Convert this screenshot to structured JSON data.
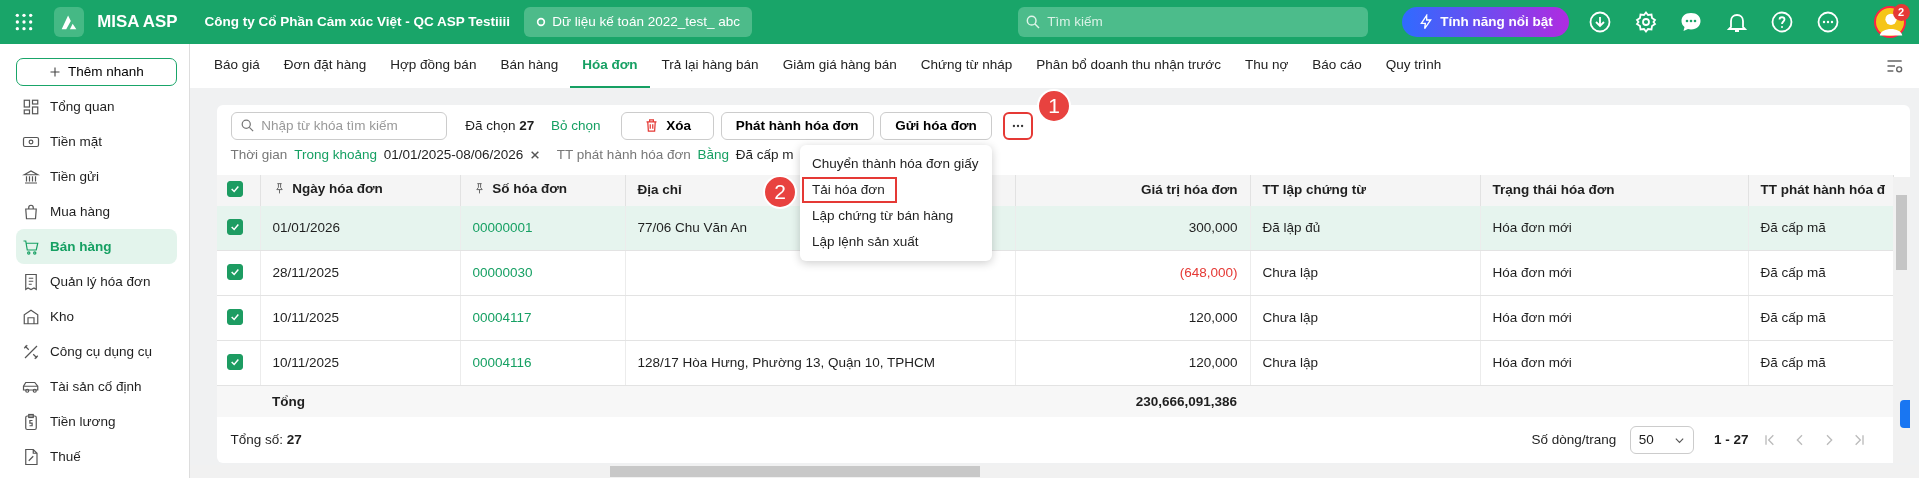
{
  "app": {
    "name": "MISA ASP",
    "company": "Công ty Cổ Phần Cảm xúc Việt - QC ASP Testiiii",
    "database": "Dữ liệu kế toán 2022_test_ abc",
    "search_placeholder": "Tìm kiếm",
    "feature_button": "Tính năng nổi bật",
    "notification_count": "2"
  },
  "sidebar": {
    "quick_add": "Thêm nhanh",
    "items": [
      {
        "label": "Tổng quan",
        "selected": false
      },
      {
        "label": "Tiền mặt",
        "selected": false
      },
      {
        "label": "Tiền gửi",
        "selected": false
      },
      {
        "label": "Mua hàng",
        "selected": false
      },
      {
        "label": "Bán hàng",
        "selected": true
      },
      {
        "label": "Quản lý hóa đơn",
        "selected": false
      },
      {
        "label": "Kho",
        "selected": false
      },
      {
        "label": "Công cụ dụng cụ",
        "selected": false
      },
      {
        "label": "Tài sản cố định",
        "selected": false
      },
      {
        "label": "Tiền lương",
        "selected": false
      },
      {
        "label": "Thuế",
        "selected": false
      }
    ]
  },
  "tabs": [
    {
      "label": "Báo giá",
      "selected": false
    },
    {
      "label": "Đơn đặt hàng",
      "selected": false
    },
    {
      "label": "Hợp đồng bán",
      "selected": false
    },
    {
      "label": "Bán hàng",
      "selected": false
    },
    {
      "label": "Hóa đơn",
      "selected": true
    },
    {
      "label": "Trả lại hàng bán",
      "selected": false
    },
    {
      "label": "Giảm giá hàng bán",
      "selected": false
    },
    {
      "label": "Chứng từ nháp",
      "selected": false
    },
    {
      "label": "Phân bổ doanh thu nhận trước",
      "selected": false
    },
    {
      "label": "Thu nợ",
      "selected": false
    },
    {
      "label": "Báo cáo",
      "selected": false
    },
    {
      "label": "Quy trình",
      "selected": false
    }
  ],
  "toolbar": {
    "search_placeholder": "Nhập từ khóa tìm kiếm",
    "selected_count": "Đã chọn **27**",
    "clear_selection": "Bỏ chọn",
    "buttons": [
      "Xóa",
      "Phát hành hóa đơn",
      "Gửi hóa đơn"
    ]
  },
  "filters": [
    {
      "field": "Thời gian",
      "operator": "Trong khoảng",
      "value": "01/01/2025-08/06/2026",
      "removable": true
    },
    {
      "field": "TT phát hành hóa đơn",
      "operator": "Bằng",
      "value": "Đã cấp m",
      "removable": false
    }
  ],
  "more_menu": {
    "items": [
      "Chuyển thành hóa đơn giấy",
      "Tải hóa đơn",
      "Lập chứng từ bán hàng",
      "Lập lệnh sản xuất"
    ]
  },
  "annotations": [
    {
      "label": "1"
    },
    {
      "label": "2"
    }
  ],
  "table": {
    "all_checked": true,
    "columns": [
      {
        "label": "Ngày hóa đơn",
        "pinned": true,
        "kind": "text"
      },
      {
        "label": "Số hóa đơn",
        "pinned": true,
        "kind": "link"
      },
      {
        "label": "Địa chỉ",
        "pinned": false,
        "kind": "text"
      },
      {
        "label": "Giá trị hóa đơn",
        "pinned": false,
        "kind": "amount"
      },
      {
        "label": "TT lập chứng từ",
        "pinned": false,
        "kind": "text"
      },
      {
        "label": "Trạng thái hóa đơn",
        "pinned": false,
        "kind": "text"
      },
      {
        "label": "TT phát hành hóa đ",
        "pinned": false,
        "kind": "text"
      }
    ],
    "rows": [
      {
        "checked": true,
        "selected": true,
        "negative": false,
        "cells": [
          "01/01/2026",
          "00000001",
          "77/06 Chu Văn An",
          "300,000",
          "Đã lập đủ",
          "Hóa đơn mới",
          "Đã cấp mã"
        ]
      },
      {
        "checked": true,
        "selected": false,
        "negative": true,
        "cells": [
          "28/11/2025",
          "00000030",
          "",
          "(648,000)",
          "Chưa lập",
          "Hóa đơn mới",
          "Đã cấp mã"
        ]
      },
      {
        "checked": true,
        "selected": false,
        "negative": false,
        "cells": [
          "10/11/2025",
          "00004117",
          "",
          "120,000",
          "Chưa lập",
          "Hóa đơn mới",
          "Đã cấp mã"
        ]
      },
      {
        "checked": true,
        "selected": false,
        "negative": false,
        "cells": [
          "10/11/2025",
          "00004116",
          "128/17 Hòa Hưng, Phường 13, Quận 10, TPHCM",
          "120,000",
          "Chưa lập",
          "Hóa đơn mới",
          "Đã cấp mã"
        ]
      }
    ],
    "totals": {
      "label": "Tổng",
      "amount": "230,666,091,386"
    }
  },
  "footer": {
    "total": "Tổng số: **27**",
    "rows_per_page_label": "Số dòng/trang",
    "rows_per_page": "50",
    "range": "1 - 27"
  }
}
